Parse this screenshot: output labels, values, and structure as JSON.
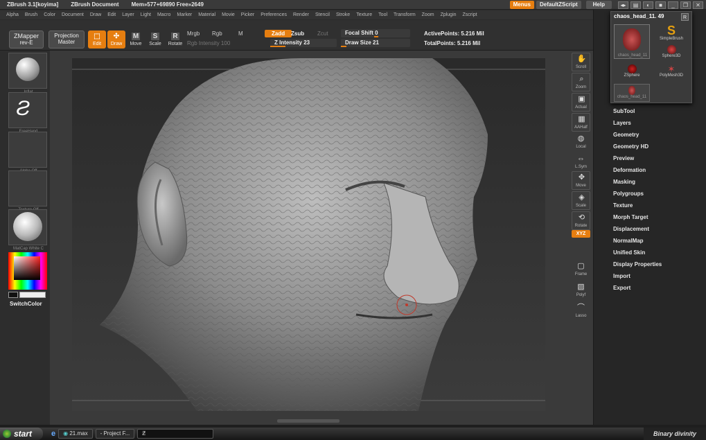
{
  "window": {
    "title": "ZBrush  3.1[koyima]",
    "document": "ZBrush Document",
    "mem_info": "Mem»577+69890 Free»2649",
    "menus_label": "Menus",
    "script_label": "DefaultZScript",
    "help_label": "Help"
  },
  "menubar": [
    "Alpha",
    "Brush",
    "Color",
    "Document",
    "Draw",
    "Edit",
    "Layer",
    "Light",
    "Macro",
    "Marker",
    "Material",
    "Movie",
    "Picker",
    "Preferences",
    "Render",
    "Stencil",
    "Stroke",
    "Texture",
    "Tool",
    "Transform",
    "Zoom",
    "Zplugin",
    "Zscript"
  ],
  "toolbar": {
    "zmapper": "ZMapper",
    "zmapper_sub": "rev-E",
    "projection": "Projection",
    "projection_sub": "Master",
    "edit": "Edit",
    "draw": "Draw",
    "move": "Move",
    "scale": "Scale",
    "rotate": "Rotate",
    "mrgb": "Mrgb",
    "rgb": "Rgb",
    "m": "M",
    "rgb_intensity": "Rgb  Intensity  100",
    "zadd": "Zadd",
    "zsub": "Zsub",
    "zcut": "Zcut",
    "z_intensity": "Z  Intensity  23",
    "focal_shift": "Focal  Shift  0",
    "draw_size": "Draw  Size  21",
    "active_points": "ActivePoints:  5.216  Mil",
    "total_points": "TotalPoints:  5.216  Mil",
    "z_intensity_value": 0.23,
    "draw_size_value": 0.08
  },
  "leftpanel": {
    "inflat": "Inflat",
    "freehand": "FreeHand",
    "alpha_off": "Alpha  Off",
    "texture_off": "Texture  Off",
    "matcap": "MatCap  White  C",
    "switch_color": "SwitchColor"
  },
  "righttools": [
    "Scroll",
    "Zoom",
    "Actual",
    "AAHalf",
    "Local",
    "L.Sym",
    "Move",
    "Scale",
    "Rotate",
    "XYZ",
    "Frame",
    "Polyf",
    "Lasso"
  ],
  "toolpop": {
    "title": "chaos_head_11. 49",
    "r_label": "R",
    "items": [
      "chaos_head_11",
      "SimpleBrush",
      "Sphere3D",
      "ZSphere",
      "PolyMesh3D",
      "chaos_head_11"
    ]
  },
  "rightmenu": [
    "SubTool",
    "Layers",
    "Geometry",
    "Geometry HD",
    "Preview",
    "Deformation",
    "Masking",
    "Polygroups",
    "Texture",
    "Morph Target",
    "Displacement",
    "NormalMap",
    "Unified Skin",
    "Display Properties",
    "Import",
    "Export"
  ],
  "taskbar": {
    "start": "start",
    "tasks": [
      "21.max",
      "- Project F...",
      ""
    ],
    "tray": "Binary divinity"
  },
  "colors": {
    "accent": "#e67e10",
    "panel": "#262626",
    "toolbar": "#303030"
  }
}
